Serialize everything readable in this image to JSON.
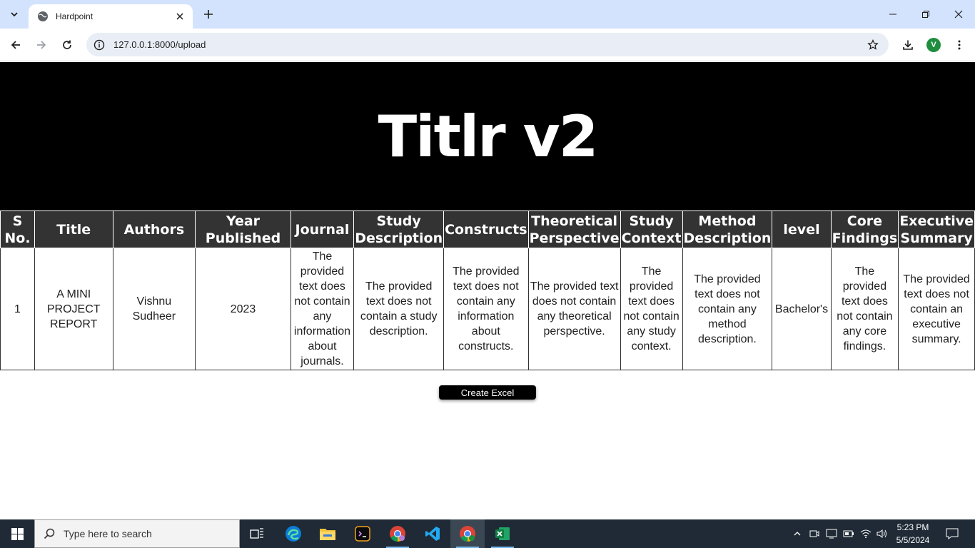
{
  "browser": {
    "tab_title": "Hardpoint",
    "url": "127.0.0.1:8000/upload",
    "profile_initial": "V"
  },
  "page": {
    "heading": "Titlr v2",
    "table": {
      "headers": [
        "S No.",
        "Title",
        "Authors",
        "Year Published",
        "Journal",
        "Study Description",
        "Constructs",
        "Theoretical Perspective",
        "Study Context",
        "Method Description",
        "level",
        "Core Findings",
        "Executive Summary"
      ],
      "rows": [
        [
          "1",
          "A MINI PROJECT REPORT",
          "Vishnu Sudheer",
          "2023",
          "The provided text does not contain any information about journals.",
          "The provided text does not contain a study description.",
          "The provided text does not contain any information about constructs.",
          "The provided text does not contain any theoretical perspective.",
          "The provided text does not contain any study context.",
          "The provided text does not contain any method description.",
          "Bachelor's",
          "The provided text does not contain any core findings.",
          "The provided text does not contain an executive summary."
        ]
      ]
    },
    "create_excel_label": "Create Excel"
  },
  "taskbar": {
    "search_placeholder": "Type here to search",
    "time": "5:23 PM",
    "date": "5/5/2024"
  },
  "colors": {
    "tabstrip": "#d3e3fd",
    "hero_bg": "#000000",
    "table_header_bg": "#333333",
    "taskbar_bg": "#1f2a36"
  }
}
